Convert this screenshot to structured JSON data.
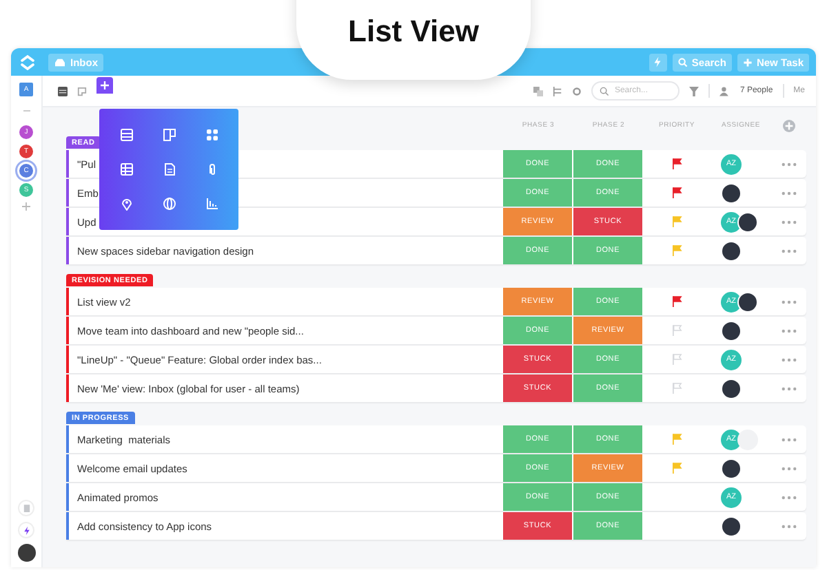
{
  "title_badge": "List View",
  "topbar": {
    "location": "Inbox",
    "search_button": "Search",
    "new_task_button": "New Task"
  },
  "sidebar": {
    "workspace": "A",
    "members": [
      {
        "initial": "J",
        "color": "#b84fd0",
        "selected": false
      },
      {
        "initial": "T",
        "color": "#e03b3b",
        "selected": false
      },
      {
        "initial": "C",
        "color": "#5b7fe0",
        "selected": true
      },
      {
        "initial": "S",
        "color": "#3fc59a",
        "selected": false
      }
    ]
  },
  "toolbar": {
    "search": {
      "placeholder": "Search..."
    },
    "people": "7 People",
    "me": "Me"
  },
  "columns": [
    "PHASE 3",
    "PHASE 2",
    "PRIORITY",
    "ASSIGNEE"
  ],
  "groups": [
    {
      "label": "READ",
      "color": "#8b4be8",
      "rows": [
        {
          "name": "\"Pul",
          "phase_3": {
            "text": "DONE",
            "kind": "done"
          },
          "phase_2": {
            "text": "DONE",
            "kind": "done"
          },
          "flag": {
            "color": "#e8202a",
            "filled": true
          },
          "assignees": [
            {
              "kind": "initials",
              "text": "AZ"
            }
          ]
        },
        {
          "name": "Emb",
          "phase_3": {
            "text": "DONE",
            "kind": "done"
          },
          "phase_2": {
            "text": "DONE",
            "kind": "done"
          },
          "flag": {
            "color": "#e8202a",
            "filled": true
          },
          "assignees": [
            {
              "kind": "photo"
            }
          ]
        },
        {
          "name": "Upd",
          "phase_3": {
            "text": "REVIEW",
            "kind": "review"
          },
          "phase_2": {
            "text": "STUCK",
            "kind": "stuck"
          },
          "flag": {
            "color": "#f7c325",
            "filled": true
          },
          "assignees": [
            {
              "kind": "initials",
              "text": "AZ"
            },
            {
              "kind": "photo"
            }
          ]
        },
        {
          "name": "New spaces sidebar navigation design",
          "phase_3": {
            "text": "DONE",
            "kind": "done"
          },
          "phase_2": {
            "text": "DONE",
            "kind": "done"
          },
          "flag": {
            "color": "#f7c325",
            "filled": true
          },
          "assignees": [
            {
              "kind": "photo"
            }
          ]
        }
      ]
    },
    {
      "label": "REVISION NEEDED",
      "color": "#ee1c25",
      "rows": [
        {
          "name": "List view v2",
          "phase_3": {
            "text": "REVIEW",
            "kind": "review"
          },
          "phase_2": {
            "text": "DONE",
            "kind": "done"
          },
          "flag": {
            "color": "#e8202a",
            "filled": true
          },
          "assignees": [
            {
              "kind": "initials",
              "text": "AZ"
            },
            {
              "kind": "photo"
            }
          ]
        },
        {
          "name": "Move team into dashboard and new \"people sid...",
          "phase_3": {
            "text": "DONE",
            "kind": "done"
          },
          "phase_2": {
            "text": "REVIEW",
            "kind": "review"
          },
          "flag": {
            "color": "#d6d8dc",
            "filled": false
          },
          "assignees": [
            {
              "kind": "photo"
            }
          ]
        },
        {
          "name": "\"LineUp\" - \"Queue\" Feature: Global order index bas...",
          "phase_3": {
            "text": "STUCK",
            "kind": "stuck"
          },
          "phase_2": {
            "text": "DONE",
            "kind": "done"
          },
          "flag": {
            "color": "#d6d8dc",
            "filled": false
          },
          "assignees": [
            {
              "kind": "initials",
              "text": "AZ"
            }
          ]
        },
        {
          "name": "New 'Me' view: Inbox (global for user - all teams)",
          "phase_3": {
            "text": "STUCK",
            "kind": "stuck"
          },
          "phase_2": {
            "text": "DONE",
            "kind": "done"
          },
          "flag": {
            "color": "#d6d8dc",
            "filled": false
          },
          "assignees": [
            {
              "kind": "photo"
            }
          ]
        }
      ]
    },
    {
      "label": "IN PROGRESS",
      "color": "#4a7fe5",
      "rows": [
        {
          "name": "Marketing  materials",
          "phase_3": {
            "text": "DONE",
            "kind": "done"
          },
          "phase_2": {
            "text": "DONE",
            "kind": "done"
          },
          "flag": {
            "color": "#f7c325",
            "filled": true
          },
          "assignees": [
            {
              "kind": "initials",
              "text": "AZ"
            },
            {
              "kind": "empty"
            }
          ]
        },
        {
          "name": "Welcome email updates",
          "phase_3": {
            "text": "DONE",
            "kind": "done"
          },
          "phase_2": {
            "text": "REVIEW",
            "kind": "review"
          },
          "flag": {
            "color": "#f7c325",
            "filled": true
          },
          "assignees": [
            {
              "kind": "photo"
            }
          ]
        },
        {
          "name": "Animated promos",
          "phase_3": {
            "text": "DONE",
            "kind": "done"
          },
          "phase_2": {
            "text": "DONE",
            "kind": "done"
          },
          "assignees": [
            {
              "kind": "initials",
              "text": "AZ"
            }
          ]
        },
        {
          "name": "Add consistency to App icons",
          "phase_3": {
            "text": "STUCK",
            "kind": "stuck"
          },
          "phase_2": {
            "text": "DONE",
            "kind": "done"
          },
          "assignees": [
            {
              "kind": "photo"
            }
          ]
        }
      ]
    }
  ]
}
